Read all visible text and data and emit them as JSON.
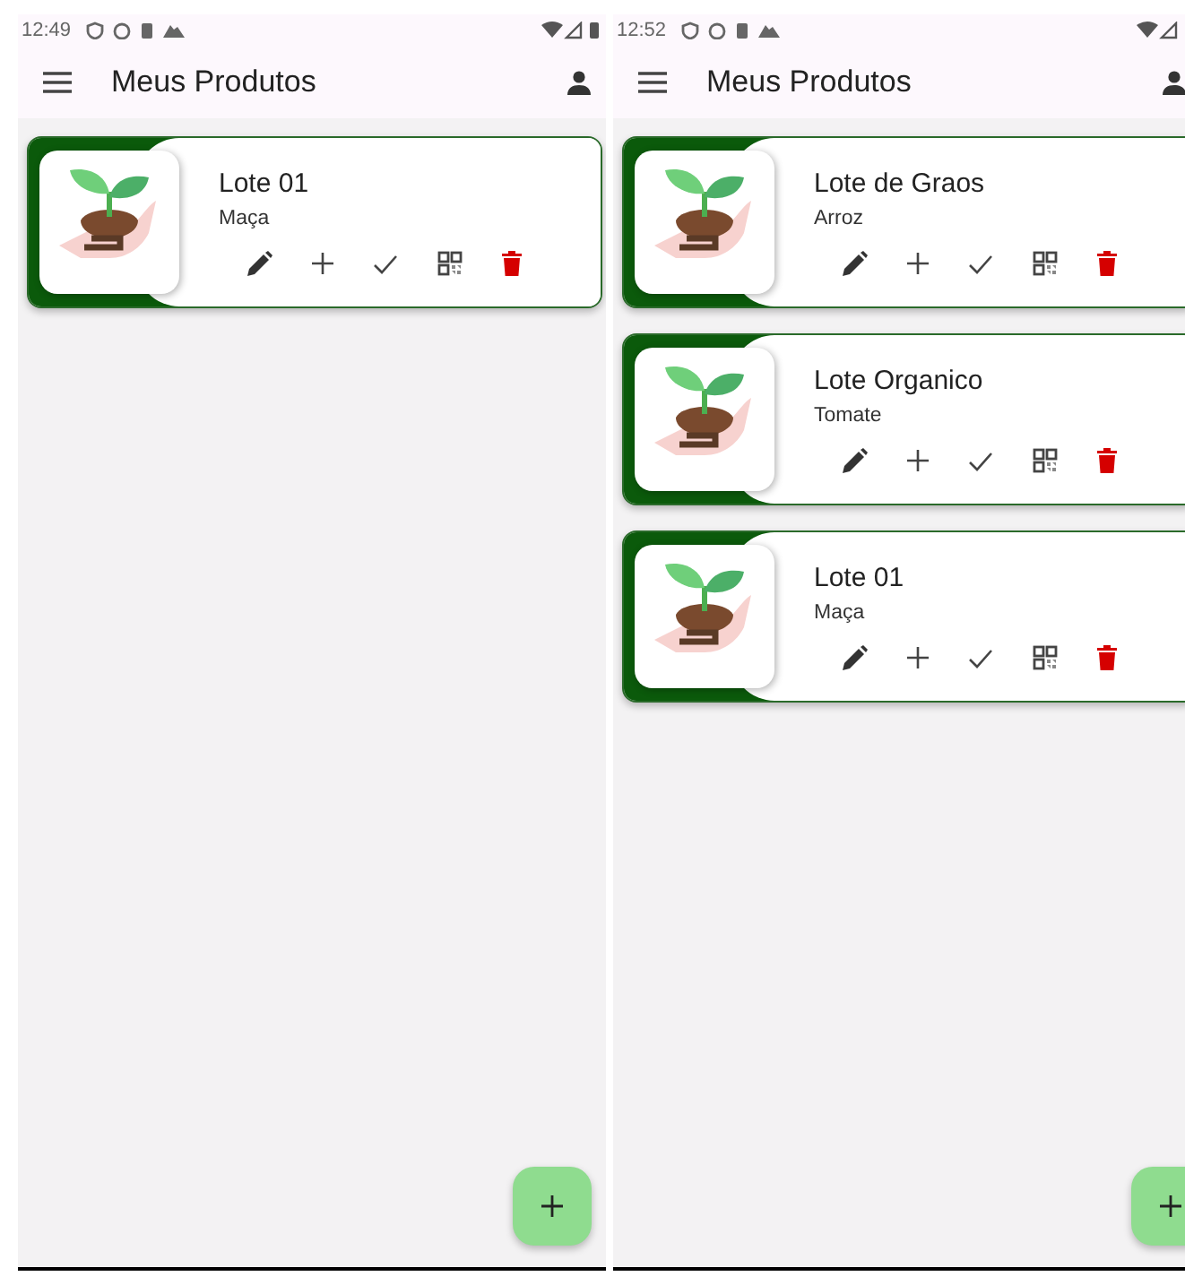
{
  "screens": [
    {
      "time": "12:49",
      "title": "Meus Produtos",
      "products": [
        {
          "name": "Lote 01",
          "variety": "Maça"
        }
      ]
    },
    {
      "time": "12:52",
      "title": "Meus Produtos",
      "products": [
        {
          "name": "Lote de Graos",
          "variety": "Arroz"
        },
        {
          "name": "Lote Organico",
          "variety": "Tomate"
        },
        {
          "name": "Lote 01",
          "variety": "Maça"
        }
      ]
    }
  ]
}
